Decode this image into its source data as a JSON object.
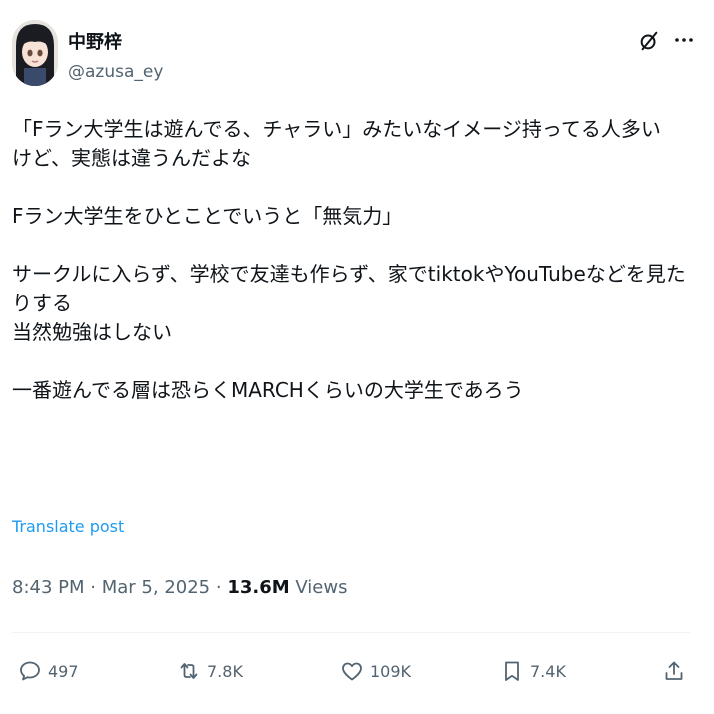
{
  "author": {
    "display_name": "中野梓",
    "handle": "@azusa_ey"
  },
  "post": {
    "paragraphs": [
      [
        "「Fラン大学生は遊んでる、チャラい」みたいなイメージ持ってる人多い",
        "けど、実態は違うんだよな"
      ],
      [
        "Fラン大学生をひとことでいうと「無気力」"
      ],
      [
        "サークルに入らず、学校で友達も作らず、家でtiktokやYouTubeなどを見た",
        "りする",
        "当然勉強はしない"
      ],
      [
        "一番遊んでる層は恐らくMARCHくらいの大学生であろう"
      ]
    ],
    "translate_label": "Translate post",
    "time": "8:43 PM",
    "date": "Mar 5, 2025",
    "separator": "·",
    "views_count": "13.6M",
    "views_label": "Views"
  },
  "actions": {
    "replies": "497",
    "reposts": "7.8K",
    "likes": "109K",
    "bookmarks": "7.4K"
  },
  "icons": [
    "grok-icon",
    "more-icon",
    "reply-icon",
    "repost-icon",
    "like-icon",
    "bookmark-icon",
    "share-icon"
  ],
  "colors": {
    "text": "#0f1419",
    "secondary": "#536471",
    "link": "#1d9bf0"
  }
}
